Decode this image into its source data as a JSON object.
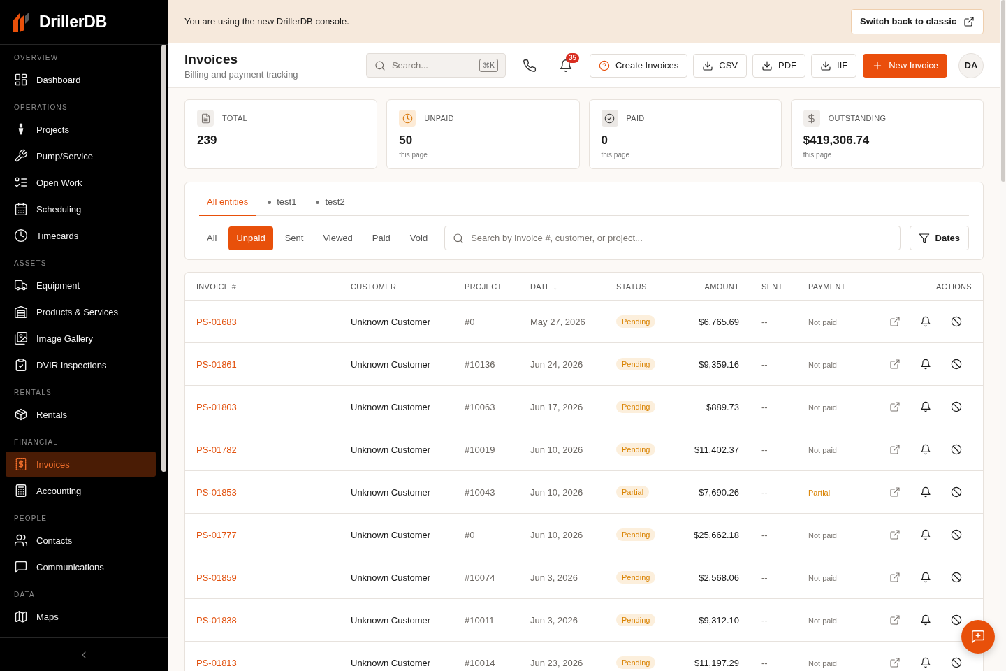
{
  "sidebar": {
    "brand": "DrillerDB",
    "sections": [
      {
        "label": "OVERVIEW",
        "items": [
          {
            "label": "Dashboard",
            "selected": false
          }
        ]
      },
      {
        "label": "OPERATIONS",
        "items": [
          {
            "label": "Projects",
            "selected": false
          },
          {
            "label": "Pump/Service",
            "selected": false
          },
          {
            "label": "Open Work",
            "selected": false
          },
          {
            "label": "Scheduling",
            "selected": false
          },
          {
            "label": "Timecards",
            "selected": false
          }
        ]
      },
      {
        "label": "ASSETS",
        "items": [
          {
            "label": "Equipment",
            "selected": false
          },
          {
            "label": "Products & Services",
            "selected": false
          },
          {
            "label": "Image Gallery",
            "selected": false
          },
          {
            "label": "DVIR Inspections",
            "selected": false
          }
        ]
      },
      {
        "label": "RENTALS",
        "items": [
          {
            "label": "Rentals",
            "selected": false
          }
        ]
      },
      {
        "label": "FINANCIAL",
        "items": [
          {
            "label": "Invoices",
            "selected": true
          },
          {
            "label": "Accounting",
            "selected": false
          }
        ]
      },
      {
        "label": "PEOPLE",
        "items": [
          {
            "label": "Contacts",
            "selected": false
          },
          {
            "label": "Communications",
            "selected": false
          }
        ]
      },
      {
        "label": "DATA",
        "items": [
          {
            "label": "Maps",
            "selected": false
          }
        ]
      }
    ]
  },
  "banner": {
    "text": "You are using the new DrillerDB console.",
    "button": "Switch back to classic"
  },
  "header": {
    "title": "Invoices",
    "subtitle": "Billing and payment tracking",
    "search": {
      "placeholder": "Search...",
      "shortcut": "⌘K"
    },
    "notifications": "35",
    "actions": [
      {
        "label": "Create Invoices",
        "kind": "help"
      },
      {
        "label": "CSV",
        "kind": "export"
      },
      {
        "label": "PDF",
        "kind": "export"
      },
      {
        "label": "IIF",
        "kind": "export"
      },
      {
        "label": "New Invoice",
        "kind": "primary"
      }
    ],
    "avatar": "DA"
  },
  "stats": [
    {
      "label": "TOTAL",
      "value": "239"
    },
    {
      "label": "UNPAID",
      "value": "50",
      "note": "this page"
    },
    {
      "label": "PAID",
      "value": "0",
      "note": "this page"
    },
    {
      "label": "OUTSTANDING",
      "value": "$419,306.74",
      "note": "this page"
    }
  ],
  "filters": {
    "entities": [
      {
        "label": "All entities",
        "kind": "all",
        "selected": true
      },
      {
        "label": "test1",
        "kind": "entity",
        "selected": false
      },
      {
        "label": "test2",
        "kind": "entity",
        "selected": false
      }
    ],
    "statuses": [
      {
        "label": "All",
        "selected": false
      },
      {
        "label": "Unpaid",
        "selected": true
      },
      {
        "label": "Sent",
        "selected": false
      },
      {
        "label": "Viewed",
        "selected": false
      },
      {
        "label": "Paid",
        "selected": false
      },
      {
        "label": "Void",
        "selected": false
      }
    ],
    "search": {
      "placeholder": "Search by invoice #, customer, or project..."
    },
    "dates_button": "Dates"
  },
  "table": {
    "columns": [
      "INVOICE #",
      "CUSTOMER",
      "PROJECT",
      "DATE ↓",
      "STATUS",
      "AMOUNT",
      "SENT",
      "PAYMENT",
      "ACTIONS"
    ],
    "rows": [
      {
        "invoice": "PS-01683",
        "customer": "Unknown Customer",
        "project": "#0",
        "date": "May 27, 2026",
        "status": "Pending",
        "amount": "$6,765.69",
        "sent": "--",
        "payment": {
          "text": "Not paid",
          "kind": "unpaid"
        }
      },
      {
        "invoice": "PS-01861",
        "customer": "Unknown Customer",
        "project": "#10136",
        "date": "Jun 24, 2026",
        "status": "Pending",
        "amount": "$9,359.16",
        "sent": "--",
        "payment": {
          "text": "Not paid",
          "kind": "unpaid"
        }
      },
      {
        "invoice": "PS-01803",
        "customer": "Unknown Customer",
        "project": "#10063",
        "date": "Jun 17, 2026",
        "status": "Pending",
        "amount": "$889.73",
        "sent": "--",
        "payment": {
          "text": "Not paid",
          "kind": "unpaid"
        }
      },
      {
        "invoice": "PS-01782",
        "customer": "Unknown Customer",
        "project": "#10019",
        "date": "Jun 10, 2026",
        "status": "Pending",
        "amount": "$11,402.37",
        "sent": "--",
        "payment": {
          "text": "Not paid",
          "kind": "unpaid"
        }
      },
      {
        "invoice": "PS-01853",
        "customer": "Unknown Customer",
        "project": "#10043",
        "date": "Jun 10, 2026",
        "status": "Partial",
        "amount": "$7,690.26",
        "sent": "--",
        "payment": {
          "text": "Partial",
          "kind": "partial"
        }
      },
      {
        "invoice": "PS-01777",
        "customer": "Unknown Customer",
        "project": "#0",
        "date": "Jun 10, 2026",
        "status": "Pending",
        "amount": "$25,662.18",
        "sent": "--",
        "payment": {
          "text": "Not paid",
          "kind": "unpaid"
        }
      },
      {
        "invoice": "PS-01859",
        "customer": "Unknown Customer",
        "project": "#10074",
        "date": "Jun 3, 2026",
        "status": "Pending",
        "amount": "$2,568.06",
        "sent": "--",
        "payment": {
          "text": "Not paid",
          "kind": "unpaid"
        }
      },
      {
        "invoice": "PS-01838",
        "customer": "Unknown Customer",
        "project": "#10011",
        "date": "Jun 3, 2026",
        "status": "Pending",
        "amount": "$9,312.10",
        "sent": "--",
        "payment": {
          "text": "Not paid",
          "kind": "unpaid"
        }
      },
      {
        "invoice": "PS-01813",
        "customer": "Unknown Customer",
        "project": "#10014",
        "date": "Jun 23, 2026",
        "status": "Pending",
        "amount": "$11,197.29",
        "sent": "--",
        "payment": {
          "text": "Not paid",
          "kind": "unpaid"
        }
      }
    ]
  }
}
